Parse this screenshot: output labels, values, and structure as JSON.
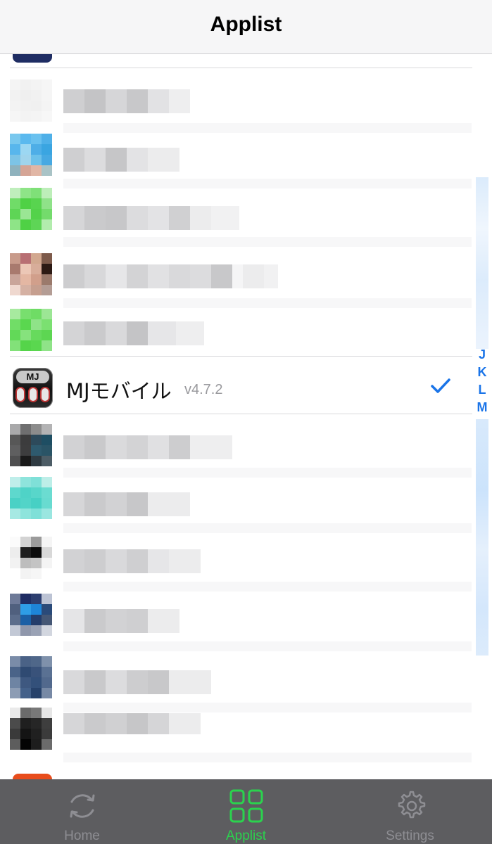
{
  "nav": {
    "title": "Applist"
  },
  "selected_app": {
    "name": "MJモバイル",
    "version": "v4.7.2",
    "icon_text": "MJ"
  },
  "index": {
    "letters": [
      "J",
      "K",
      "L",
      "M"
    ]
  },
  "tabs": [
    {
      "label": "Home",
      "icon": "refresh-icon"
    },
    {
      "label": "Applist",
      "icon": "grid-icon"
    },
    {
      "label": "Settings",
      "icon": "gear-icon"
    }
  ],
  "colors": {
    "accent": "#2bd24e",
    "check": "#1a74e8",
    "tabbar": "#5d5d60"
  }
}
